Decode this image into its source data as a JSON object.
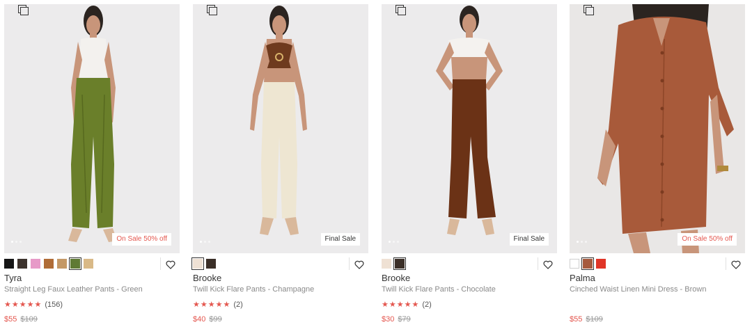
{
  "products": [
    {
      "name": "Tyra",
      "description": "Straight Leg Faux Leather Pants - Green",
      "stars": "★★★★★",
      "review_count": "(156)",
      "sale_price": "$55",
      "original_price": "$109",
      "tag": "On Sale 50% off",
      "swatches": [
        "#161616",
        "#3d332d",
        "#e79ac8",
        "#b06c37",
        "#c49866",
        "#5f7a34",
        "#d9b987"
      ],
      "selected_swatch": 5
    },
    {
      "name": "Brooke",
      "description": "Twill Kick Flare Pants - Champagne",
      "stars": "★★★★★",
      "review_count": "(2)",
      "sale_price": "$40",
      "original_price": "$99",
      "tag": "Final Sale",
      "swatches": [
        "#efe1d4",
        "#3b2f28"
      ],
      "selected_swatch": 0
    },
    {
      "name": "Brooke",
      "description": "Twill Kick Flare Pants - Chocolate",
      "stars": "★★★★★",
      "review_count": "(2)",
      "sale_price": "$30",
      "original_price": "$79",
      "tag": "Final Sale",
      "swatches": [
        "#efe1d4",
        "#3b2f28"
      ],
      "selected_swatch": 1
    },
    {
      "name": "Palma",
      "description": "Cinched Waist Linen Mini Dress - Brown",
      "stars": "",
      "review_count": "",
      "sale_price": "$55",
      "original_price": "$109",
      "tag": "On Sale 50% off",
      "swatches": [
        "#ffffff",
        "#a65b3f",
        "#e03527"
      ],
      "selected_swatch": 1
    }
  ],
  "colors": {
    "accent_sale": "#e4574f",
    "photo_bg": "#ecebec"
  },
  "icons": {
    "compare": "compare-icon",
    "wishlist": "heart-icon"
  }
}
